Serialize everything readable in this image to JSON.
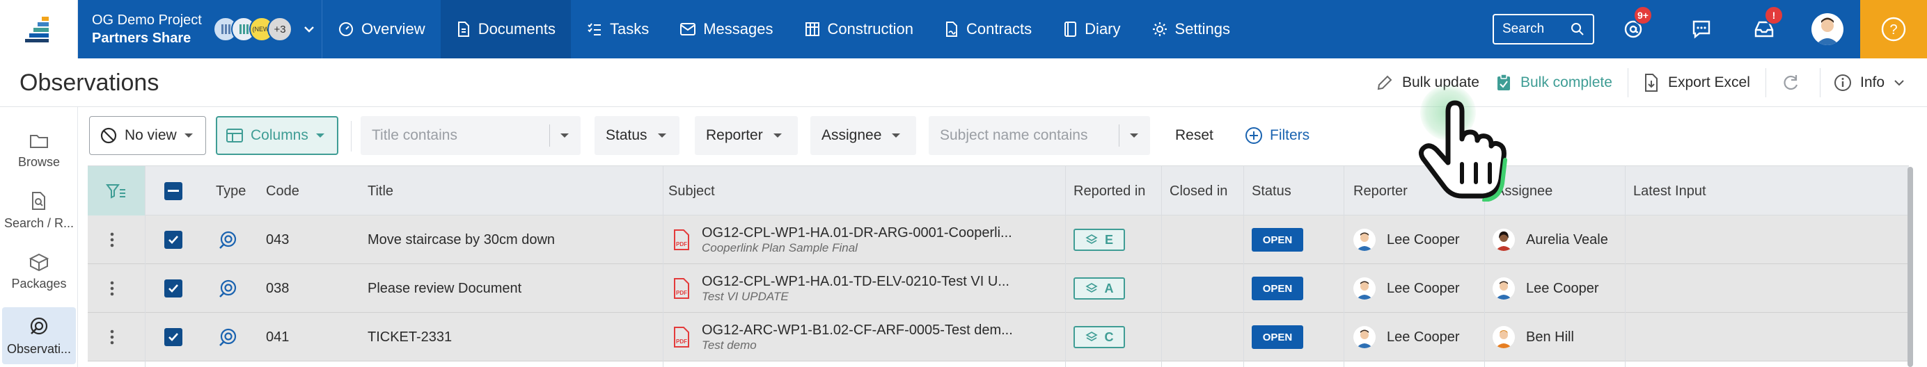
{
  "project": {
    "name": "OG Demo Project",
    "subtitle": "Partners Share",
    "more_members": "+3",
    "member_initial": "(NEW)"
  },
  "nav": [
    {
      "key": "overview",
      "label": "Overview",
      "icon": "overview-icon"
    },
    {
      "key": "documents",
      "label": "Documents",
      "icon": "document-icon",
      "active": true
    },
    {
      "key": "tasks",
      "label": "Tasks",
      "icon": "tasks-icon"
    },
    {
      "key": "messages",
      "label": "Messages",
      "icon": "mail-icon"
    },
    {
      "key": "construction",
      "label": "Construction",
      "icon": "construction-icon"
    },
    {
      "key": "contracts",
      "label": "Contracts",
      "icon": "contract-icon"
    },
    {
      "key": "diary",
      "label": "Diary",
      "icon": "diary-icon"
    },
    {
      "key": "settings",
      "label": "Settings",
      "icon": "gear-icon"
    }
  ],
  "search": {
    "label": "Search"
  },
  "badges": {
    "mentions": "9+",
    "inbox": "!"
  },
  "help": {
    "label": "?"
  },
  "page": {
    "title": "Observations"
  },
  "header_actions": {
    "bulk_update": "Bulk update",
    "bulk_complete": "Bulk complete",
    "export_excel": "Export Excel",
    "info": "Info"
  },
  "sidebar": [
    {
      "key": "browse",
      "label": "Browse"
    },
    {
      "key": "search",
      "label": "Search / R..."
    },
    {
      "key": "packages",
      "label": "Packages"
    },
    {
      "key": "observations",
      "label": "Observati...",
      "active": true
    }
  ],
  "filters": {
    "view": "No view",
    "columns": "Columns",
    "title_placeholder": "Title contains",
    "status": "Status",
    "reporter": "Reporter",
    "assignee": "Assignee",
    "subject_placeholder": "Subject name contains",
    "reset": "Reset",
    "more_filters": "Filters"
  },
  "columns": [
    "Type",
    "Code",
    "Title",
    "Subject",
    "Reported in",
    "Closed in",
    "Status",
    "Reporter",
    "Assignee",
    "Latest Input"
  ],
  "rows": [
    {
      "code": "043",
      "title": "Move staircase by 30cm down",
      "subject": "OG12-CPL-WP1-HA.01-DR-ARG-0001-Cooperli...",
      "subject_sub": "Cooperlink Plan Sample Final",
      "reported_in": "E",
      "closed_in": "",
      "status": "OPEN",
      "reporter": "Lee Cooper",
      "assignee": "Aurelia Veale",
      "latest_input": ""
    },
    {
      "code": "038",
      "title": "Please review Document",
      "subject": "OG12-CPL-WP1-HA.01-TD-ELV-0210-Test VI U...",
      "subject_sub": "Test VI UPDATE",
      "reported_in": "A",
      "closed_in": "",
      "status": "OPEN",
      "reporter": "Lee Cooper",
      "assignee": "Lee Cooper",
      "latest_input": ""
    },
    {
      "code": "041",
      "title": "TICKET-2331",
      "subject": "OG12-ARC-WP1-B1.02-CF-ARF-0005-Test dem...",
      "subject_sub": "Test demo",
      "reported_in": "C",
      "closed_in": "",
      "status": "OPEN",
      "reporter": "Lee Cooper",
      "assignee": "Ben Hill",
      "latest_input": ""
    }
  ],
  "colors": {
    "brand": "#0f5cad",
    "accent": "#3f9d95",
    "help": "#f2a41b",
    "badge": "#e33b3b"
  }
}
